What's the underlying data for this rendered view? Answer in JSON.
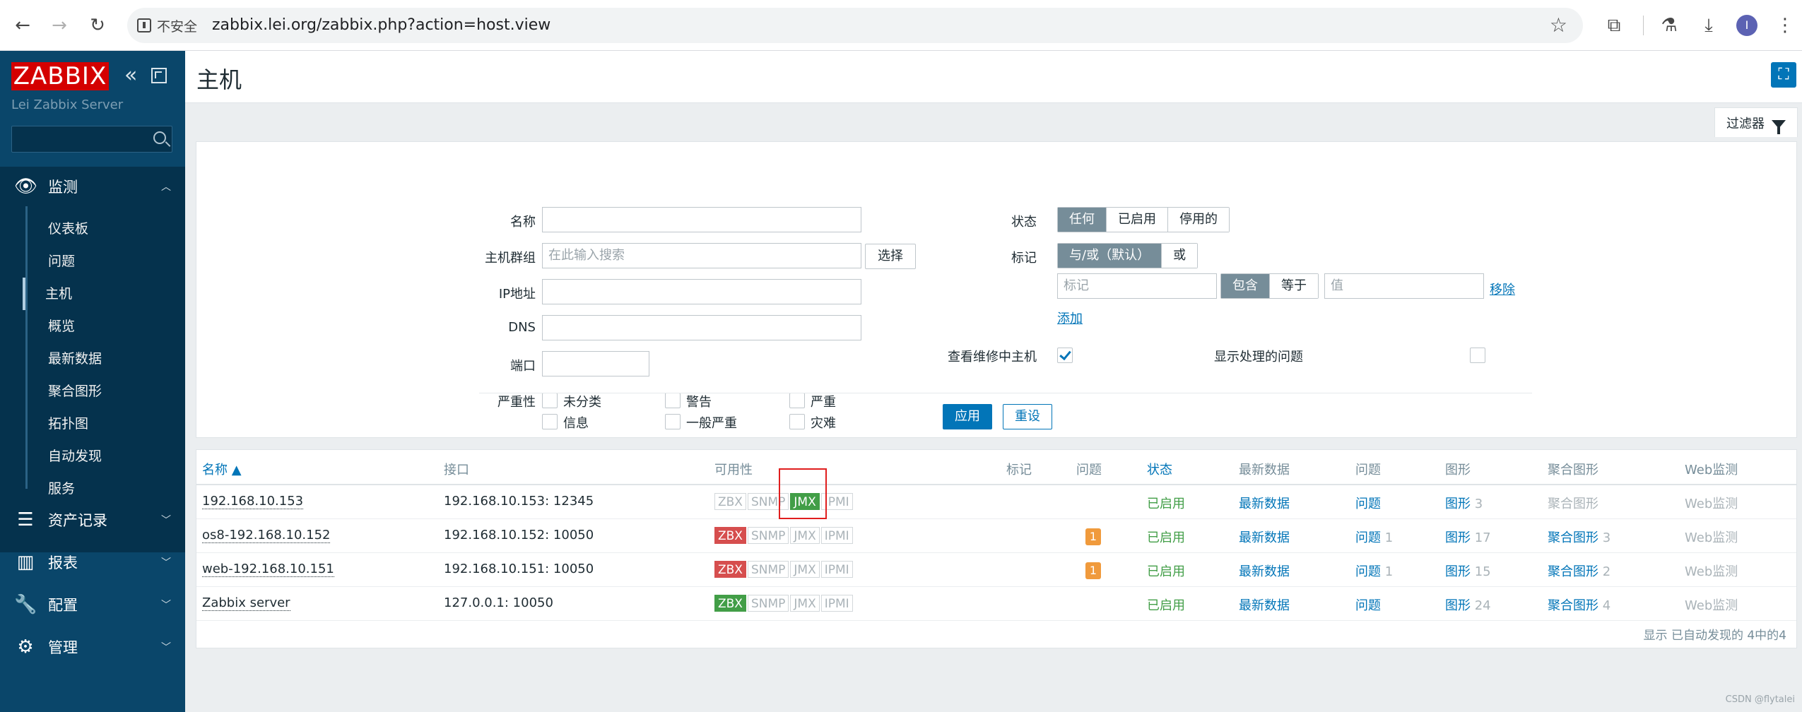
{
  "browser": {
    "security_label": "不安全",
    "url": "zabbix.lei.org/zabbix.php?action=host.view",
    "profile_initial": "I"
  },
  "sidebar": {
    "logo": "ZABBIX",
    "server_name": "Lei Zabbix Server",
    "search_placeholder": "",
    "menu": [
      {
        "label": "监测",
        "icon": "eye-icon",
        "expanded": true
      },
      {
        "label": "资产记录",
        "icon": "list-icon"
      },
      {
        "label": "报表",
        "icon": "bar-chart-icon"
      },
      {
        "label": "配置",
        "icon": "wrench-icon"
      },
      {
        "label": "管理",
        "icon": "gear-icon"
      }
    ],
    "submenu": [
      "仪表板",
      "问题",
      "主机",
      "概览",
      "最新数据",
      "聚合图形",
      "拓扑图",
      "自动发现",
      "服务"
    ],
    "selected_submenu": "主机"
  },
  "page": {
    "title": "主机",
    "filter_tab": "过滤器"
  },
  "filter": {
    "name_label": "名称",
    "hostgroup_label": "主机群组",
    "hostgroup_placeholder": "在此输入搜索",
    "select_button": "选择",
    "ip_label": "IP地址",
    "dns_label": "DNS",
    "port_label": "端口",
    "severity_label": "严重性",
    "severities": [
      "未分类",
      "警告",
      "严重",
      "信息",
      "一般严重",
      "灾难"
    ],
    "status_label": "状态",
    "status_options": [
      "任何",
      "已启用",
      "停用的"
    ],
    "status_selected": "任何",
    "tags_label": "标记",
    "tag_mode_options": [
      "与/或（默认）",
      "或"
    ],
    "tag_placeholder": "标记",
    "tag_operator_options": [
      "包含",
      "等于"
    ],
    "tag_value_placeholder": "值",
    "remove_link": "移除",
    "add_link": "添加",
    "maintenance_label": "查看维修中主机",
    "maintenance_checked": true,
    "suppressed_label": "显示处理的问题",
    "suppressed_checked": false,
    "apply_button": "应用",
    "reset_button": "重设"
  },
  "table": {
    "headers": [
      "名称 ▲",
      "接口",
      "可用性",
      "标记",
      "问题",
      "状态",
      "最新数据",
      "问题",
      "图形",
      "聚合图形",
      "Web监测"
    ],
    "rows": [
      {
        "name": "192.168.10.153",
        "interface": "192.168.10.153: 12345",
        "zbx": "none",
        "snmp": "none",
        "jmx": "ok",
        "ipmi": "none",
        "problems": "",
        "status": "已启用",
        "latest": "最新数据",
        "problems_link": "问题",
        "problems_count": "",
        "graphs": "图形",
        "graphs_count": "3",
        "screens": "聚合图形",
        "screens_count": "",
        "web": "Web监测"
      },
      {
        "name": "os8-192.168.10.152",
        "interface": "192.168.10.152: 10050",
        "zbx": "err",
        "snmp": "none",
        "jmx": "none",
        "ipmi": "none",
        "problems": "1",
        "status": "已启用",
        "latest": "最新数据",
        "problems_link": "问题",
        "problems_count": "1",
        "graphs": "图形",
        "graphs_count": "17",
        "screens": "聚合图形",
        "screens_count": "3",
        "web": "Web监测"
      },
      {
        "name": "web-192.168.10.151",
        "interface": "192.168.10.151: 10050",
        "zbx": "err",
        "snmp": "none",
        "jmx": "none",
        "ipmi": "none",
        "problems": "1",
        "status": "已启用",
        "latest": "最新数据",
        "problems_link": "问题",
        "problems_count": "1",
        "graphs": "图形",
        "graphs_count": "15",
        "screens": "聚合图形",
        "screens_count": "2",
        "web": "Web监测"
      },
      {
        "name": "Zabbix server",
        "interface": "127.0.0.1: 10050",
        "zbx": "ok",
        "snmp": "none",
        "jmx": "none",
        "ipmi": "none",
        "problems": "",
        "status": "已启用",
        "latest": "最新数据",
        "problems_link": "问题",
        "problems_count": "",
        "graphs": "图形",
        "graphs_count": "24",
        "screens": "聚合图形",
        "screens_count": "4",
        "web": "Web监测"
      }
    ],
    "avail_labels": [
      "ZBX",
      "SNMP",
      "JMX",
      "IPMI"
    ],
    "footer": "显示 已自动发现的 4中的4"
  },
  "watermark": "CSDN @flytalei",
  "colors": {
    "sidebar": "#0a466a",
    "accent": "#0275b8",
    "ok": "#429e47",
    "error": "#d64e4e",
    "warning": "#f09a3c",
    "logo": "#d40000"
  }
}
